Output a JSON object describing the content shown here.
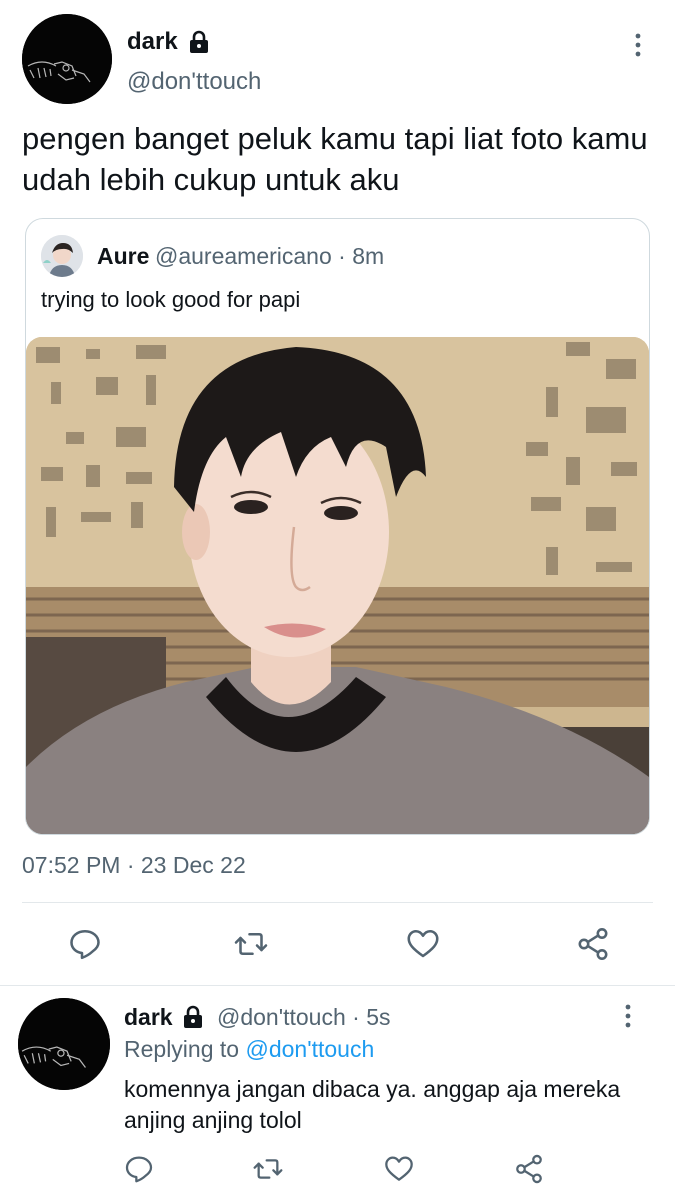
{
  "tweet": {
    "author_name": "dark",
    "author_handle": "@don'ttouch",
    "text": "pengen banget peluk kamu tapi liat foto kamu udah lebih cukup untuk aku",
    "timestamp": "07:52 PM · 23 Dec 22",
    "icons": [
      "lock-icon",
      "more-vertical-icon",
      "reply-icon",
      "retweet-icon",
      "like-icon",
      "share-icon"
    ]
  },
  "quote": {
    "author_name": "Aure",
    "handle_time": "@aureamericano · 8m",
    "text": "trying to look good for papi"
  },
  "reply": {
    "author_name": "dark",
    "handle_time": "@don'ttouch · 5s",
    "replying_prefix": "Replying to ",
    "replying_mention": "@don'ttouch",
    "text": "komennya jangan dibaca ya. anggap aja mereka anjing anjing tolol"
  },
  "colors": {
    "primary_text": "#0f1419",
    "secondary_text": "#536471",
    "link": "#1d9bf0",
    "border": "#cfd9de"
  }
}
